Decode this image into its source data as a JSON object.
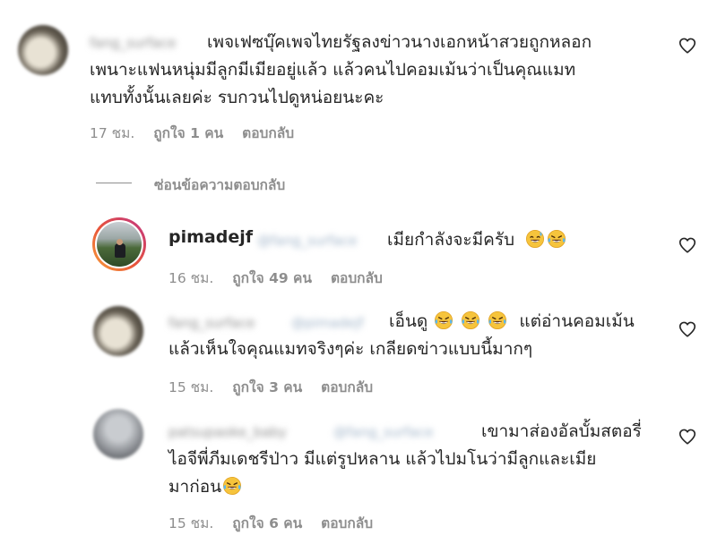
{
  "comments": [
    {
      "username_blurred": "fang_surface",
      "text_lines": [
        "เพจเฟซบุ๊คเพจไทยรัฐลงข่าวนางเอกหน้าสวยถูกหลอก",
        "เพนาะแฟนหนุ่มมีลูกมีเมียอยู่แล้ว แล้วคนไปคอมเม้นว่าเป็นคุณแมท",
        "แทบทั้งนั้นเลยค่ะ รบกวนไปดูหน่อยนะคะ"
      ],
      "time": "17 ชม.",
      "likes": "ถูกใจ 1 คน",
      "reply": "ตอบกลับ"
    }
  ],
  "hide_replies": "ซ่อนข้อความตอบกลับ",
  "replies": [
    {
      "username": "pimadejf",
      "mention_blurred": "@fang_surface",
      "text": "เมียกำลังจะมีครับ",
      "emojis": [
        "sweat-smile",
        "tears-of-joy"
      ],
      "time": "16 ชม.",
      "likes": "ถูกใจ 49 คน",
      "reply": "ตอบกลับ"
    },
    {
      "username_blurred": "fang_surface",
      "mention_blurred": "@pimadejf",
      "text_line1": "เอ็นดู",
      "text_line1_after": "แต่อ่านคอมเม้น",
      "text_line2": "แล้วเห็นใจคุณแมทจริงๆค่ะ เกลียดข่าวแบบนี้มากๆ",
      "emojis": [
        "tears-of-joy",
        "tears-of-joy",
        "tears-of-joy"
      ],
      "time": "15 ชม.",
      "likes": "ถูกใจ 3 คน",
      "reply": "ตอบกลับ"
    },
    {
      "username_blurred": "patsupaoke_baby",
      "mention_blurred": "@fang_surface",
      "text_line1": "เขามาส่องอัลบั้มสตอรี่",
      "text_line2": "ไอจีพี่ภีมเดชรีป่าว มีแต่รูปหลาน แล้วไปมโนว่ามีลูกและเมีย",
      "text_line3": "มาก่อน",
      "emojis": [
        "tears-of-joy"
      ],
      "time": "15 ชม.",
      "likes": "ถูกใจ 6 คน",
      "reply": "ตอบกลับ"
    }
  ],
  "colors": {
    "text": "#262626",
    "secondary": "#8e8e8e",
    "story_ring_start": "#f9a13a",
    "story_ring_end": "#c13584"
  }
}
